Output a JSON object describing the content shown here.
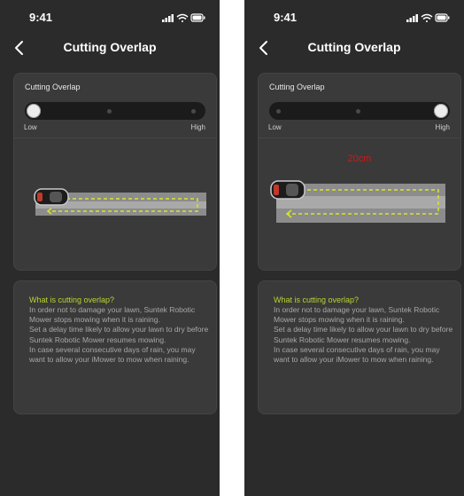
{
  "status_bar": {
    "time": "9:41"
  },
  "header": {
    "title": "Cutting Overlap"
  },
  "setting": {
    "label": "Cutting Overlap",
    "low_label": "Low",
    "high_label": "High"
  },
  "screens": [
    {
      "slider_level": 0.0,
      "overlap_label": ""
    },
    {
      "slider_level": 1.0,
      "overlap_label": "20cm"
    }
  ],
  "info": {
    "question": "What is cutting overlap?",
    "paragraph1": "In order not to damage your lawn, Suntek Robotic Mower stops mowing when it is raining.",
    "paragraph2": "Set a delay time likely to allow your lawn to dry before Suntek Robotic Mower resumes mowing.",
    "paragraph3": "In case several consecutive days of rain, you may want to allow your iMower to mow when raining."
  },
  "colors": {
    "background": "#2b2b2b",
    "card": "#3a3a3a",
    "accent": "#b8d432",
    "path_line": "#d6e629",
    "overlap_label": "#d01818"
  },
  "icons": [
    "signal-icon",
    "wifi-icon",
    "battery-icon",
    "back-arrow-icon",
    "mower-icon"
  ]
}
